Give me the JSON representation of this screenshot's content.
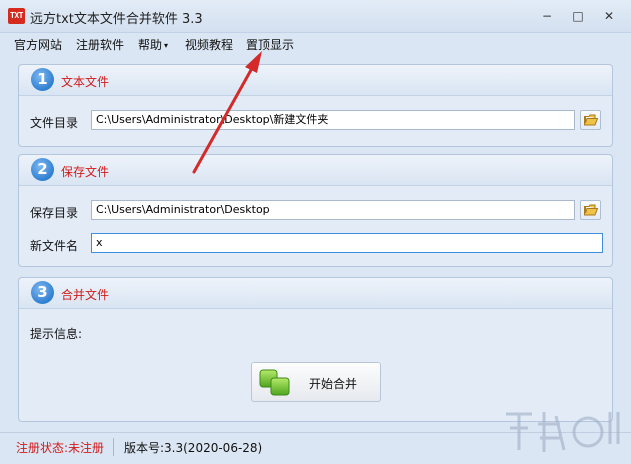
{
  "window": {
    "icon_text": "TXT",
    "title": "远方txt文本文件合并软件 3.3",
    "minimize": "−",
    "maximize": "□",
    "close": "✕"
  },
  "menu": {
    "items": [
      {
        "label": "官方网站"
      },
      {
        "label": "注册软件"
      },
      {
        "label": "帮助",
        "caret": "▾"
      },
      {
        "label": "视频教程"
      },
      {
        "label": "置顶显示"
      }
    ]
  },
  "section1": {
    "number": "1",
    "title": "文本文件",
    "dir_label": "文件目录",
    "dir_value": "C:\\Users\\Administrator\\Desktop\\新建文件夹"
  },
  "section2": {
    "number": "2",
    "title": "保存文件",
    "dir_label": "保存目录",
    "dir_value": "C:\\Users\\Administrator\\Desktop",
    "name_label": "新文件名",
    "name_value": "x"
  },
  "section3": {
    "number": "3",
    "title": "合并文件",
    "info_label": "提示信息:",
    "merge_button": "开始合并"
  },
  "status": {
    "registration": "注册状态:未注册",
    "version": "版本号:3.3(2020-06-28)"
  },
  "colors": {
    "accent_red": "#d11a1a",
    "step_blue": "#2f7fd1",
    "annotation_arrow": "#d42a2a"
  }
}
